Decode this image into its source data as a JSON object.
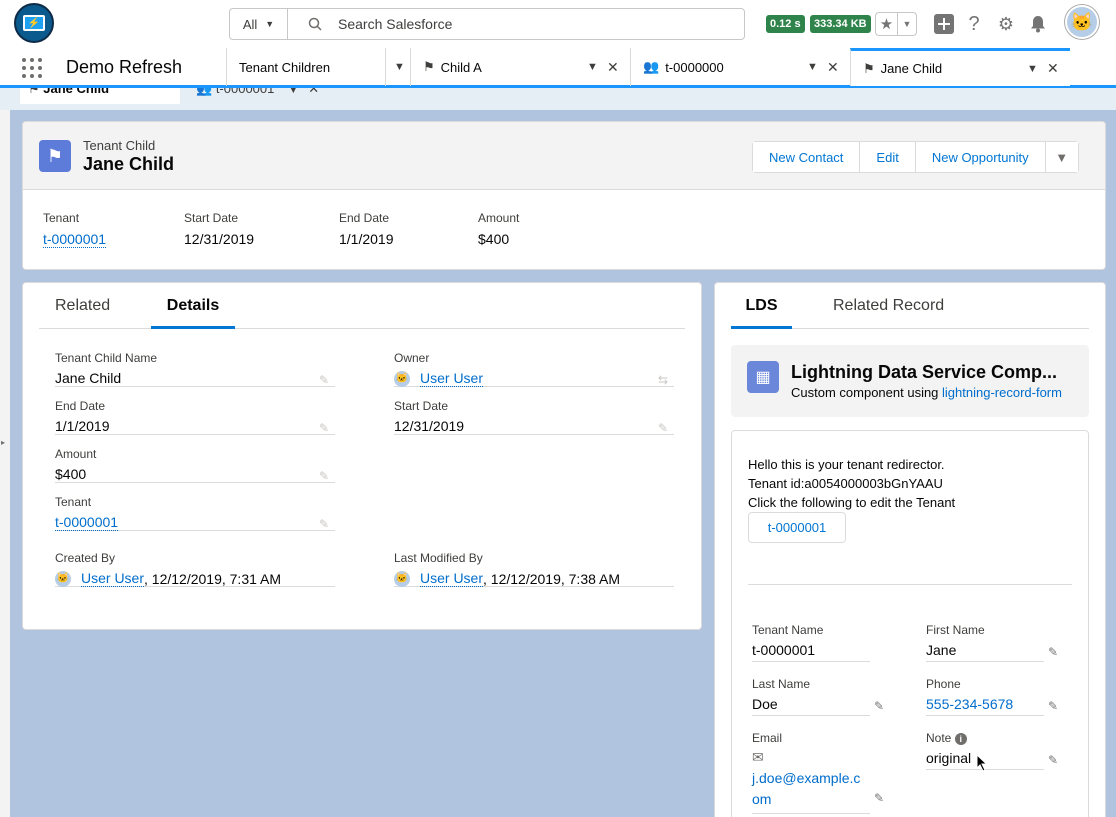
{
  "header": {
    "search_scope": "All",
    "search_placeholder": "Search Salesforce",
    "timing_badge": "0.12 s",
    "size_badge": "333.34 KB"
  },
  "nav": {
    "app_name": "Demo Refresh",
    "tabs": [
      {
        "label": "Tenant Children"
      },
      {
        "label": "Child A"
      },
      {
        "label": "t-0000000"
      },
      {
        "label": "Jane Child"
      }
    ]
  },
  "subtabs": [
    {
      "label": "Jane Child"
    },
    {
      "label": "t-0000001"
    }
  ],
  "record": {
    "object_label": "Tenant Child",
    "title": "Jane Child",
    "actions": [
      "New Contact",
      "Edit",
      "New Opportunity"
    ],
    "highlights": [
      {
        "label": "Tenant",
        "value": "t-0000001"
      },
      {
        "label": "Start Date",
        "value": "12/31/2019"
      },
      {
        "label": "End Date",
        "value": "1/1/2019"
      },
      {
        "label": "Amount",
        "value": "$400"
      }
    ]
  },
  "detail": {
    "tabs": [
      "Related",
      "Details"
    ],
    "fields": {
      "name_label": "Tenant Child Name",
      "name_value": "Jane Child",
      "owner_label": "Owner",
      "owner_value": "User User",
      "end_label": "End Date",
      "end_value": "1/1/2019",
      "start_label": "Start Date",
      "start_value": "12/31/2019",
      "amount_label": "Amount",
      "amount_value": "$400",
      "tenant_label": "Tenant",
      "tenant_value": "t-0000001",
      "created_label": "Created By",
      "created_user": "User User",
      "created_date": ", 12/12/2019, 7:31 AM",
      "modified_label": "Last Modified By",
      "modified_user": "User User",
      "modified_date": ", 12/12/2019, 7:38 AM"
    }
  },
  "lds": {
    "tabs": [
      "LDS",
      "Related Record"
    ],
    "title": "Lightning Data Service Comp...",
    "subtitle_prefix": "Custom component using ",
    "subtitle_link": "lightning-record-form",
    "line1": "Hello this is your tenant redirector.",
    "line2": "Tenant id:a0054000003bGnYAAU",
    "line3": "Click the following to edit the Tenant",
    "button": "t-0000001",
    "form": {
      "tenant_name_label": "Tenant Name",
      "tenant_name_value": "t-0000001",
      "first_label": "First Name",
      "first_value": "Jane",
      "last_label": "Last Name",
      "last_value": "Doe",
      "phone_label": "Phone",
      "phone_value": "555-234-5678",
      "email_label": "Email",
      "email_value": "j.doe@example.c\nom",
      "note_label": "Note",
      "note_value": "original"
    }
  }
}
